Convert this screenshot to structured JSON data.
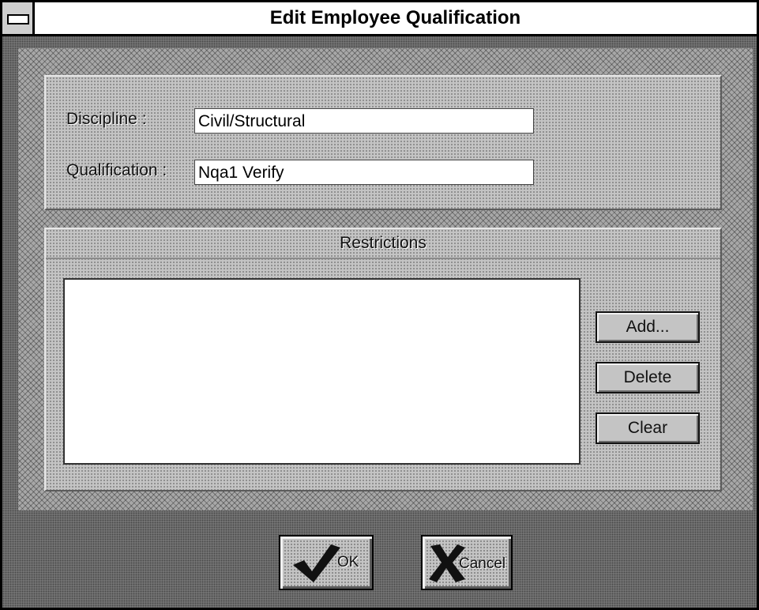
{
  "window": {
    "title": "Edit Employee Qualification"
  },
  "form": {
    "discipline_label": "Discipline :",
    "discipline_value": "Civil/Structural",
    "qualification_label": "Qualification :",
    "qualification_value": "Nqa1 Verify"
  },
  "restrictions": {
    "header": "Restrictions",
    "items": [],
    "add_label": "Add...",
    "delete_label": "Delete",
    "clear_label": "Clear"
  },
  "footer": {
    "ok_label": "OK",
    "cancel_label": "Cancel"
  },
  "icons": {
    "system_menu": "system-menu-icon",
    "ok": "checkmark-icon",
    "cancel": "x-cross-icon"
  }
}
